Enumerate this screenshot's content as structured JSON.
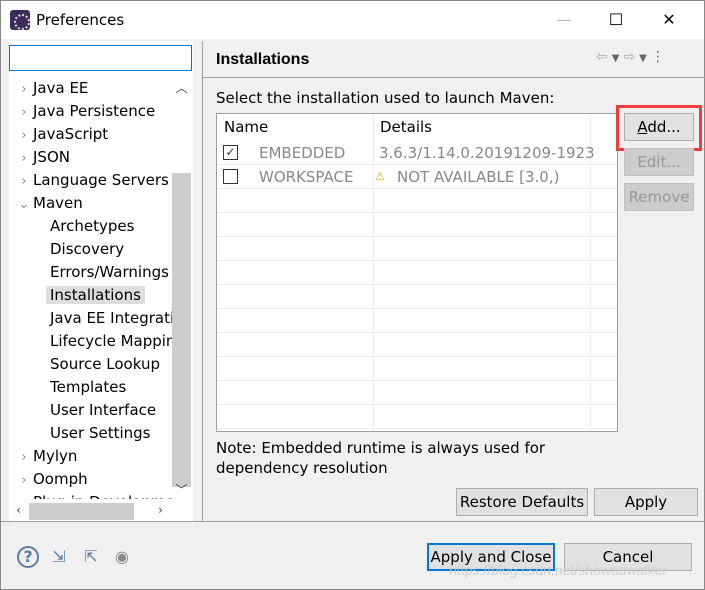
{
  "window": {
    "title": "Preferences",
    "minimize": "—",
    "maximize": "☐",
    "close": "✕"
  },
  "search": {
    "value": "",
    "placeholder": ""
  },
  "tree": [
    {
      "label": "Java EE",
      "level": 0
    },
    {
      "label": "Java Persistence",
      "level": 0
    },
    {
      "label": "JavaScript",
      "level": 0
    },
    {
      "label": "JSON",
      "level": 0
    },
    {
      "label": "Language Servers",
      "level": 0
    },
    {
      "label": "Maven",
      "level": 0,
      "expanded": true
    },
    {
      "label": "Archetypes",
      "level": 1
    },
    {
      "label": "Discovery",
      "level": 1
    },
    {
      "label": "Errors/Warnings",
      "level": 1
    },
    {
      "label": "Installations",
      "level": 1,
      "selected": true
    },
    {
      "label": "Java EE Integration",
      "level": 1
    },
    {
      "label": "Lifecycle Mappings",
      "level": 1
    },
    {
      "label": "Source Lookup",
      "level": 1
    },
    {
      "label": "Templates",
      "level": 1
    },
    {
      "label": "User Interface",
      "level": 1
    },
    {
      "label": "User Settings",
      "level": 1
    },
    {
      "label": "Mylyn",
      "level": 0
    },
    {
      "label": "Oomph",
      "level": 0
    },
    {
      "label": "Plug-in Development",
      "level": 0
    }
  ],
  "page": {
    "title": "Installations",
    "prompt": "Select the installation used to launch Maven:",
    "note": "Note: Embedded runtime is always used for dependency resolution"
  },
  "table": {
    "columns": [
      "Name",
      "Details"
    ],
    "rows": [
      {
        "checked": true,
        "name": "EMBEDDED",
        "details": "3.6.3/1.14.0.20191209-1923",
        "warning": false
      },
      {
        "checked": false,
        "name": "WORKSPACE",
        "details": "NOT AVAILABLE [3.0,)",
        "warning": true
      }
    ]
  },
  "buttons": {
    "add": "Add...",
    "edit": "Edit...",
    "remove": "Remove",
    "restore": "Restore Defaults",
    "apply": "Apply",
    "apply_close": "Apply and Close",
    "cancel": "Cancel"
  },
  "watermark": "https://blog.csdn.net/showadwalker",
  "colors": {
    "accent": "#0078d7",
    "highlight": "#f03c3c"
  }
}
